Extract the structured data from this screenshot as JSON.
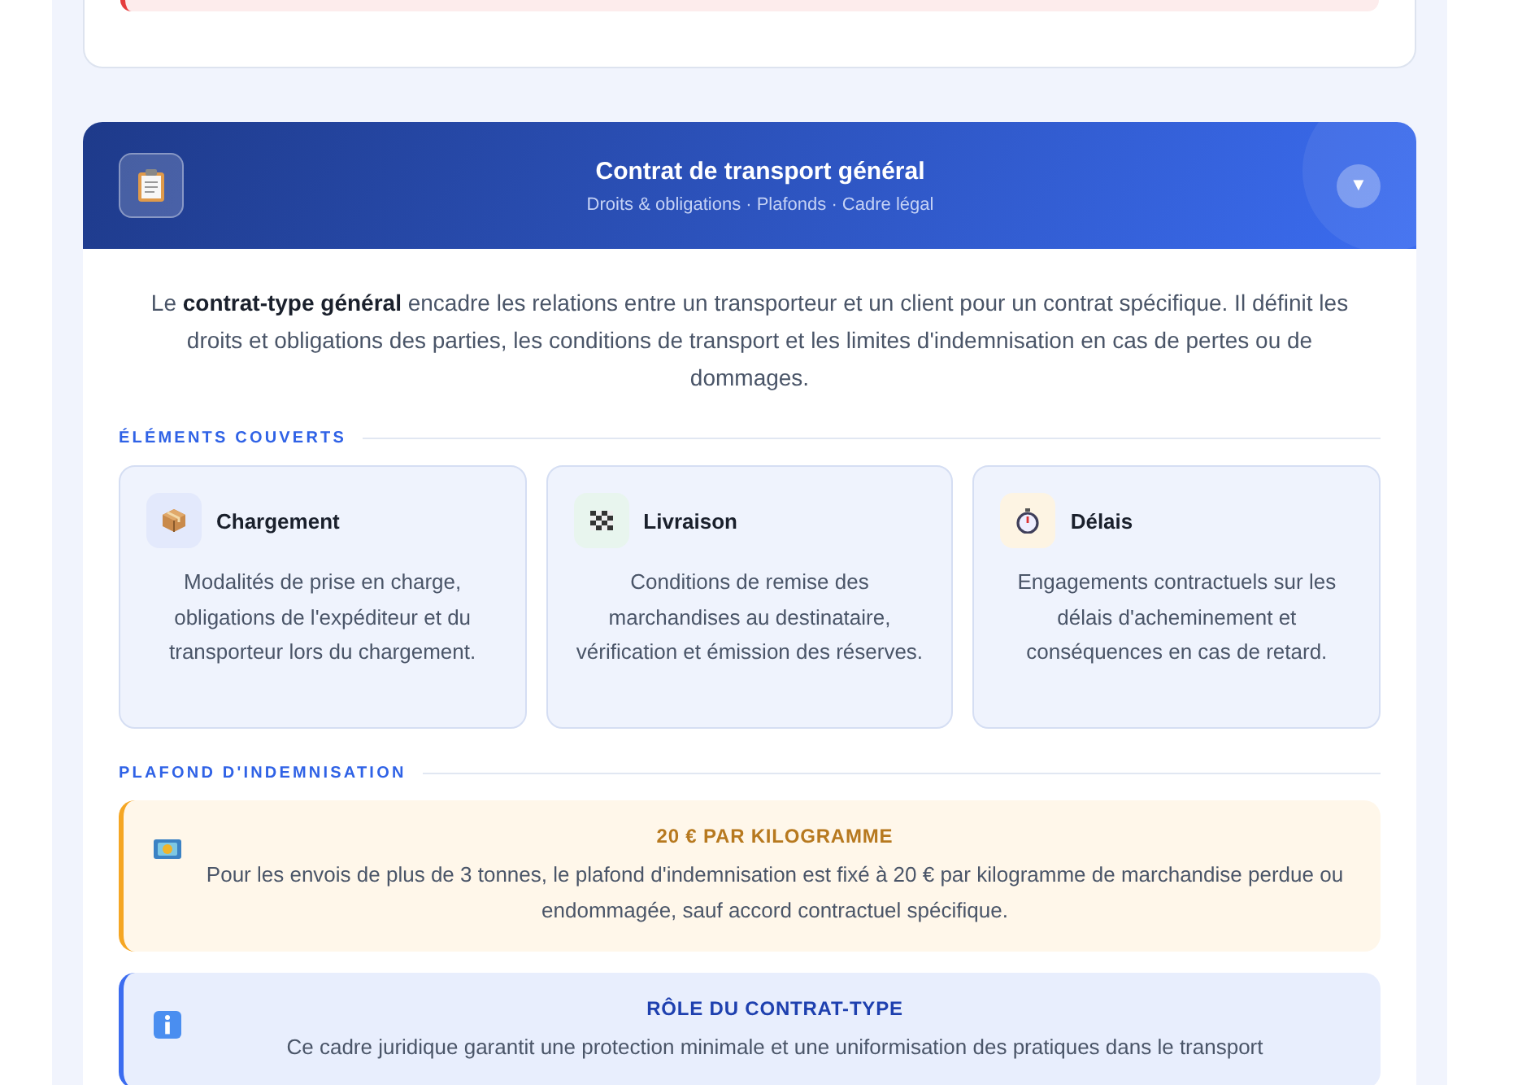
{
  "header": {
    "title": "Contrat de transport général",
    "subtitle": "Droits & obligations · Plafonds · Cadre légal",
    "toggle": "▼"
  },
  "intro": "Le **contrat-type général** encadre les relations entre un transporteur et un client pour un contrat spécifique. Il définit les droits et obligations des parties, les conditions de transport et les limites d'indemnisation en cas de pertes ou de dommages.",
  "covered": {
    "heading": "ÉLÉMENTS COUVERTS",
    "items": [
      {
        "kind": "box",
        "title": "Chargement",
        "text": "Modalités de prise en charge, obligations de l'expéditeur et du transporteur lors du chargement."
      },
      {
        "kind": "flag",
        "title": "Livraison",
        "text": "Conditions de remise des marchandises au destinataire, vérification et émission des réserves."
      },
      {
        "kind": "stopwatch",
        "title": "Délais",
        "text": "Engagements contractuels sur les délais d'acheminement et conséquences en cas de retard."
      }
    ]
  },
  "ceiling": {
    "heading": "PLAFOND D'INDEMNISATION",
    "notes": [
      {
        "kind": "money",
        "title": "20 € PAR KILOGRAMME",
        "text": "Pour les envois de plus de 3 tonnes, le plafond d'indemnisation est fixé à 20 € par kilogramme de marchandise perdue ou endommagée, sauf accord contractuel spécifique."
      },
      {
        "kind": "info",
        "title": "RÔLE DU CONTRAT-TYPE",
        "text": "Ce cadre juridique garantit une protection minimale et une uniformisation des pratiques dans le transport"
      }
    ]
  }
}
